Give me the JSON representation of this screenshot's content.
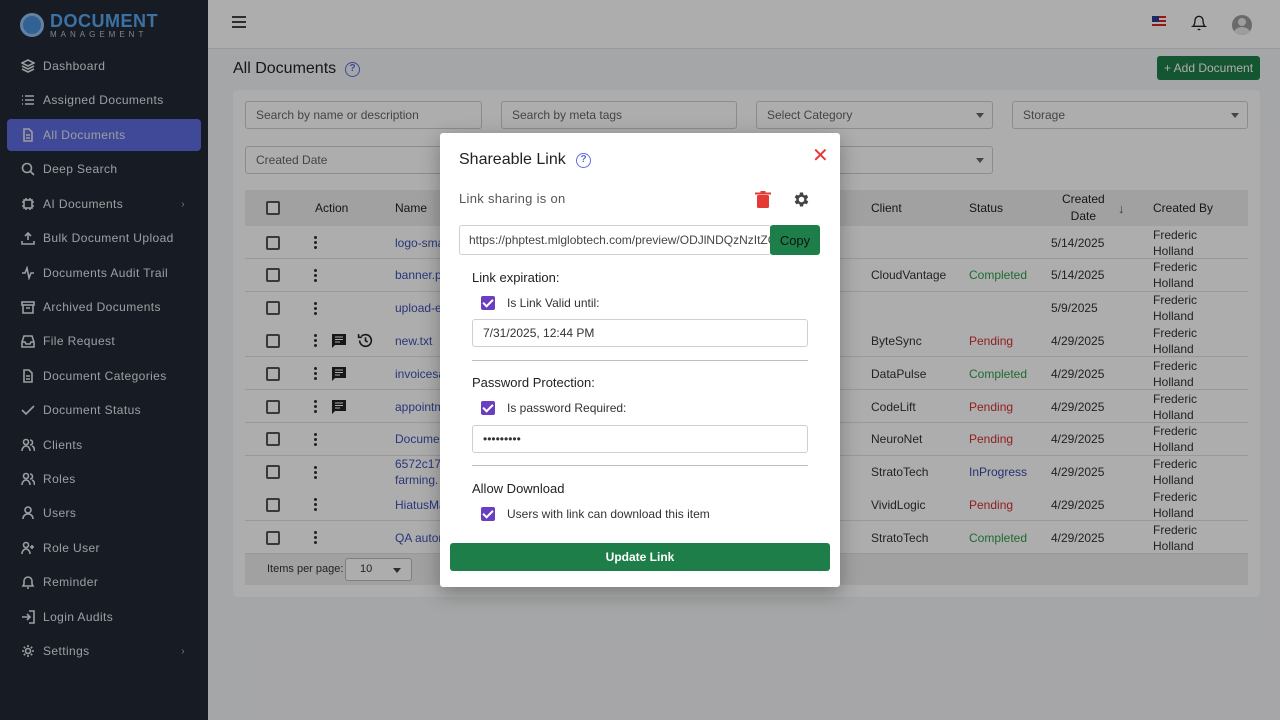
{
  "app": {
    "logo_main": "DOCUMENT",
    "logo_sub": "MANAGEMENT"
  },
  "sidebar": {
    "items": [
      {
        "label": "Dashboard",
        "icon": "layers-icon"
      },
      {
        "label": "Assigned Documents",
        "icon": "list-icon"
      },
      {
        "label": "All Documents",
        "icon": "file-icon",
        "active": true
      },
      {
        "label": "Deep Search",
        "icon": "search-icon"
      },
      {
        "label": "AI Documents",
        "icon": "chip-icon",
        "chevron": true
      },
      {
        "label": "Bulk Document Upload",
        "icon": "upload-icon"
      },
      {
        "label": "Documents Audit Trail",
        "icon": "activity-icon"
      },
      {
        "label": "Archived Documents",
        "icon": "archive-icon"
      },
      {
        "label": "File Request",
        "icon": "inbox-icon"
      },
      {
        "label": "Document Categories",
        "icon": "file-icon"
      },
      {
        "label": "Document Status",
        "icon": "check-icon"
      },
      {
        "label": "Clients",
        "icon": "users-icon"
      },
      {
        "label": "Roles",
        "icon": "users-icon"
      },
      {
        "label": "Users",
        "icon": "user-icon"
      },
      {
        "label": "Role User",
        "icon": "user-plus-icon"
      },
      {
        "label": "Reminder",
        "icon": "bell-icon"
      },
      {
        "label": "Login Audits",
        "icon": "login-icon"
      },
      {
        "label": "Settings",
        "icon": "gear-icon",
        "chevron": true
      }
    ]
  },
  "page": {
    "title": "All Documents",
    "add_button": "+ Add Document"
  },
  "filters": {
    "search_name": "Search by name or description",
    "search_meta": "Search by meta tags",
    "category": "Select Category",
    "storage": "Storage",
    "created_date": "Created Date"
  },
  "table": {
    "headers": {
      "action": "Action",
      "name": "Name",
      "client": "Client",
      "status": "Status",
      "created_date_1": "Created",
      "created_date_2": "Date",
      "created_by": "Created By",
      "sort_icon": "↓"
    },
    "rows": [
      {
        "name": "logo-sma",
        "client": "",
        "status": "",
        "status_class": "",
        "date": "5/14/2025",
        "by1": "Frederic",
        "by2": "Holland",
        "icons": []
      },
      {
        "name": "banner.p",
        "client": "CloudVantage",
        "status": "Completed",
        "status_class": "completed",
        "date": "5/14/2025",
        "by1": "Frederic",
        "by2": "Holland",
        "icons": []
      },
      {
        "name": "upload-e",
        "client": "",
        "status": "",
        "status_class": "",
        "date": "5/9/2025",
        "by1": "Frederic",
        "by2": "Holland",
        "icons": []
      },
      {
        "name": "new.txt",
        "client": "ByteSync",
        "status": "Pending",
        "status_class": "pending",
        "date": "4/29/2025",
        "by1": "Frederic",
        "by2": "Holland",
        "icons": [
          "comment",
          "history"
        ]
      },
      {
        "name": "invoicesa",
        "client": "DataPulse",
        "status": "Completed",
        "status_class": "completed",
        "date": "4/29/2025",
        "by1": "Frederic",
        "by2": "Holland",
        "icons": [
          "comment"
        ]
      },
      {
        "name": "appointm",
        "client": "CodeLift",
        "status": "Pending",
        "status_class": "pending",
        "date": "4/29/2025",
        "by1": "Frederic",
        "by2": "Holland",
        "icons": [
          "comment"
        ]
      },
      {
        "name": "Documen",
        "client": "NeuroNet",
        "status": "Pending",
        "status_class": "pending",
        "date": "4/29/2025",
        "by1": "Frederic",
        "by2": "Holland",
        "icons": []
      },
      {
        "name": "6572c17",
        "name2": "farming.",
        "client": "StratoTech",
        "status": "InProgress",
        "status_class": "inprogress",
        "date": "4/29/2025",
        "by1": "Frederic",
        "by2": "Holland",
        "icons": []
      },
      {
        "name": "HiatusMa",
        "client": "VividLogic",
        "status": "Pending",
        "status_class": "pending",
        "date": "4/29/2025",
        "by1": "Frederic",
        "by2": "Holland",
        "icons": []
      },
      {
        "name": "QA autor",
        "client": "StratoTech",
        "status": "Completed",
        "status_class": "completed",
        "date": "4/29/2025",
        "by1": "Frederic",
        "by2": "Holland",
        "icons": []
      }
    ]
  },
  "pagination": {
    "label": "Items per page:",
    "value": "10"
  },
  "modal": {
    "title": "Shareable Link",
    "status_text": "Link sharing is on",
    "url": "https://phptest.mlglobtech.com/preview/ODJlNDQzNzItZGE",
    "copy_label": "Copy",
    "expiration_label": "Link expiration:",
    "valid_until_label": "Is Link Valid until:",
    "valid_until_value": "7/31/2025, 12:44 PM",
    "password_label": "Password Protection:",
    "password_required_label": "Is password Required:",
    "password_value": "•••••••••",
    "download_label": "Allow Download",
    "download_checkbox_label": "Users with link can download this item",
    "update_button": "Update Link",
    "close_symbol": "✕"
  },
  "colors": {
    "sidebar_bg": "#232a36",
    "active_nav": "#5d6ce0",
    "primary_green": "#1e7e4a",
    "checkbox_purple": "#6a3fbf",
    "delete_red": "#e53935"
  }
}
